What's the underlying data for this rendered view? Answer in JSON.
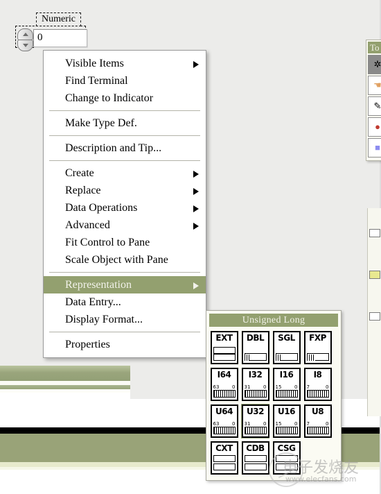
{
  "background": {
    "base_color": "#ececea",
    "accent_olive": "#93a06f",
    "band_olive": "#99a378",
    "band_black": "#000000"
  },
  "numeric_control": {
    "label": "Numeric",
    "value": "0",
    "increment_icon": "triangle-up-icon",
    "decrement_icon": "triangle-down-icon"
  },
  "context_menu": {
    "items": [
      {
        "label": "Visible Items",
        "submenu": true,
        "selected": false
      },
      {
        "label": "Find Terminal",
        "submenu": false,
        "selected": false
      },
      {
        "label": "Change to Indicator",
        "submenu": false,
        "selected": false
      },
      {
        "label": "Make Type Def.",
        "submenu": false,
        "selected": false
      },
      {
        "label": "Description and Tip...",
        "submenu": false,
        "selected": false
      },
      {
        "label": "Create",
        "submenu": true,
        "selected": false
      },
      {
        "label": "Replace",
        "submenu": true,
        "selected": false
      },
      {
        "label": "Data Operations",
        "submenu": true,
        "selected": false
      },
      {
        "label": "Advanced",
        "submenu": true,
        "selected": false
      },
      {
        "label": "Fit Control to Pane",
        "submenu": false,
        "selected": false
      },
      {
        "label": "Scale Object with Pane",
        "submenu": false,
        "selected": false
      },
      {
        "label": "Representation",
        "submenu": true,
        "selected": true
      },
      {
        "label": "Data Entry...",
        "submenu": false,
        "selected": false
      },
      {
        "label": "Display Format...",
        "submenu": false,
        "selected": false
      },
      {
        "label": "Properties",
        "submenu": false,
        "selected": false
      }
    ],
    "separators_after": [
      2,
      3,
      4,
      10,
      13
    ]
  },
  "representation_submenu": {
    "header": "Unsigned Long",
    "types": [
      {
        "code": "EXT",
        "msb": "",
        "lsb": "",
        "selected": false
      },
      {
        "code": "DBL",
        "msb": "",
        "lsb": "",
        "selected": false
      },
      {
        "code": "SGL",
        "msb": "",
        "lsb": "",
        "selected": false
      },
      {
        "code": "FXP",
        "msb": "",
        "lsb": "",
        "selected": false
      },
      {
        "code": "I64",
        "msb": "63",
        "lsb": "0",
        "selected": false
      },
      {
        "code": "I32",
        "msb": "31",
        "lsb": "0",
        "selected": false
      },
      {
        "code": "I16",
        "msb": "15",
        "lsb": "0",
        "selected": false
      },
      {
        "code": "I8",
        "msb": "7",
        "lsb": "0",
        "selected": false
      },
      {
        "code": "U64",
        "msb": "63",
        "lsb": "0",
        "selected": false
      },
      {
        "code": "U32",
        "msb": "31",
        "lsb": "0",
        "selected": true
      },
      {
        "code": "U16",
        "msb": "15",
        "lsb": "0",
        "selected": false
      },
      {
        "code": "U8",
        "msb": "7",
        "lsb": "0",
        "selected": false
      },
      {
        "code": "CXT",
        "msb": "",
        "lsb": "",
        "selected": false
      },
      {
        "code": "CDB",
        "msb": "",
        "lsb": "",
        "selected": false
      },
      {
        "code": "CSG",
        "msb": "",
        "lsb": "",
        "selected": false
      }
    ]
  },
  "tools_palette": {
    "title": "To",
    "tools": [
      {
        "name": "operate-value-tool",
        "glyph": "✲",
        "active": true
      },
      {
        "name": "position-size-select-tool",
        "glyph": "☚",
        "active": false
      },
      {
        "name": "edit-text-tool",
        "glyph": "✎",
        "active": false
      },
      {
        "name": "set-color-tool",
        "glyph": "●",
        "active": false
      },
      {
        "name": "scroll-window-tool",
        "glyph": "■",
        "active": false
      }
    ]
  },
  "watermark": {
    "text_cn": "电子发烧友",
    "url": "www.elecfans.com"
  }
}
